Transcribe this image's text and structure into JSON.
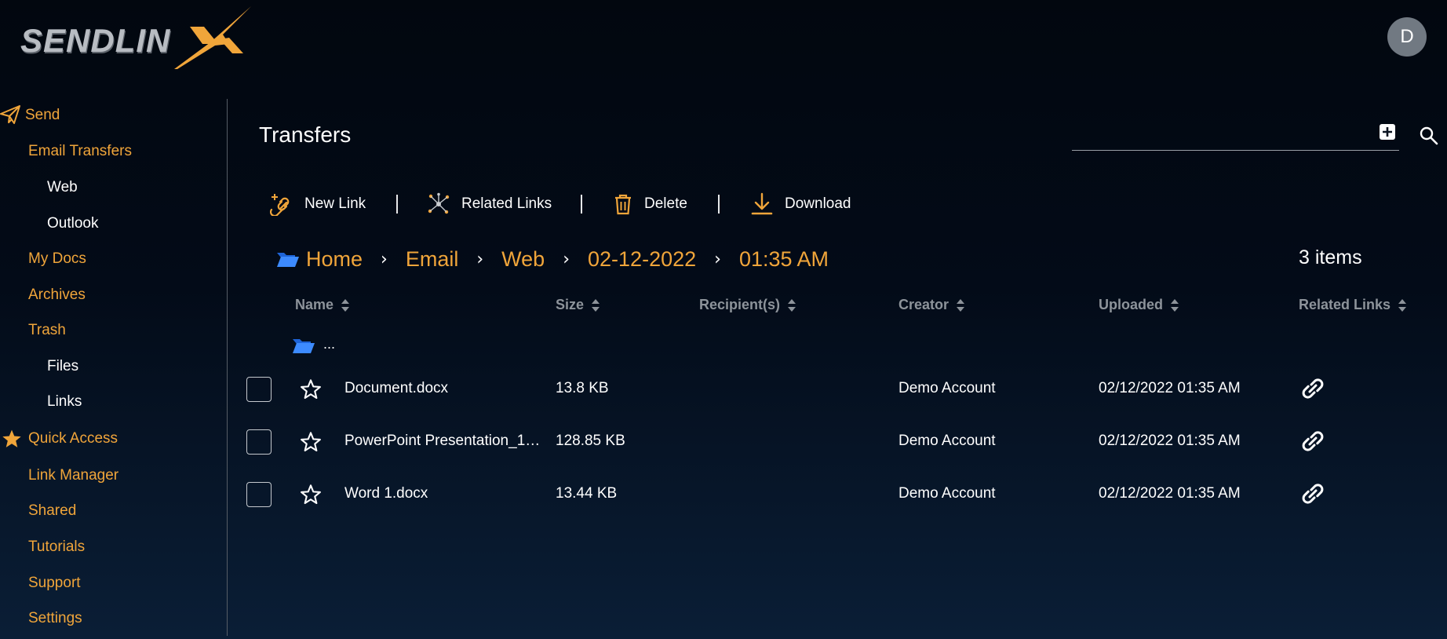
{
  "brand": {
    "logo_text": "SENDLIN",
    "accent_color": "#f0a53a"
  },
  "user": {
    "avatar_initial": "D"
  },
  "sidebar": {
    "items": [
      {
        "label": "Send",
        "icon": "paper-plane-icon"
      },
      {
        "label": "Email Transfers"
      },
      {
        "label": "Web"
      },
      {
        "label": "Outlook"
      },
      {
        "label": "My Docs"
      },
      {
        "label": "Archives"
      },
      {
        "label": "Trash"
      },
      {
        "label": "Files"
      },
      {
        "label": "Links"
      },
      {
        "label": "Quick Access",
        "icon": "star-icon"
      },
      {
        "label": "Link Manager"
      },
      {
        "label": "Shared"
      },
      {
        "label": "Tutorials"
      },
      {
        "label": "Support"
      },
      {
        "label": "Settings"
      }
    ]
  },
  "main": {
    "title": "Transfers",
    "search": {
      "placeholder": "",
      "value": ""
    },
    "toolbar": {
      "new_link": "New Link",
      "related_links": "Related Links",
      "delete": "Delete",
      "download": "Download"
    },
    "breadcrumb": [
      "Home",
      "Email",
      "Web",
      "02-12-2022",
      "01:35 AM"
    ],
    "items_count": "3 items",
    "columns": [
      "Name",
      "Size",
      "Recipient(s)",
      "Creator",
      "Uploaded",
      "Related Links"
    ],
    "parent_folder_label": "...",
    "rows": [
      {
        "name": "Document.docx",
        "size": "13.8 KB",
        "recipients": "",
        "creator": "Demo Account",
        "uploaded": "02/12/2022 01:35 AM"
      },
      {
        "name": "PowerPoint Presentation_1.p...",
        "size": "128.85 KB",
        "recipients": "",
        "creator": "Demo Account",
        "uploaded": "02/12/2022 01:35 AM"
      },
      {
        "name": "Word 1.docx",
        "size": "13.44 KB",
        "recipients": "",
        "creator": "Demo Account",
        "uploaded": "02/12/2022 01:35 AM"
      }
    ]
  }
}
